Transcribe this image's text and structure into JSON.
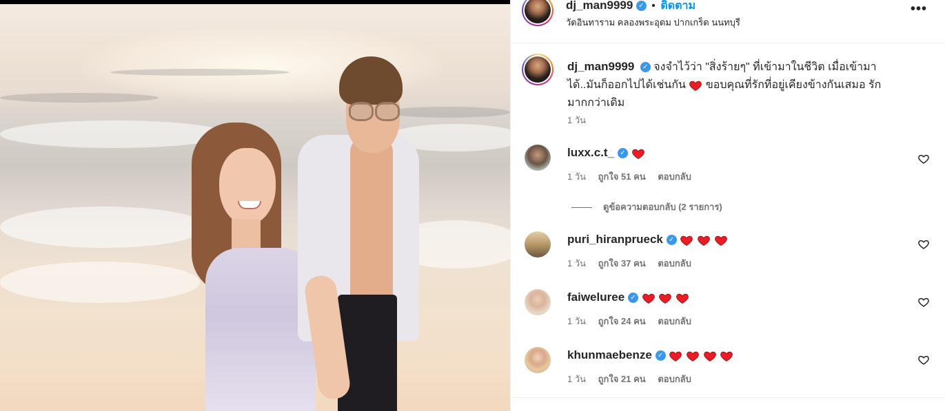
{
  "post": {
    "author": "dj_man9999",
    "follow_label": "ติดตาม",
    "separator": "•",
    "location": "วัดอินทาราม คลองพระอุดม ปากเกร็ด นนทบุรี",
    "more_label": "•••",
    "caption": "จงจำไว้ว่า \"สิ่งร้ายๆ\" ที่เข้ามาในชีวิต เมื่อเข้ามาได้..มันก็ออกไปได้เช่นกัน ❤️ ขอบคุณที่รักที่อยู่เคียงข้างกันเสมอ รักมากกว่าเดิม",
    "caption_part1": "จงจำไว้ว่า \"สิ่งร้ายๆ\" ที่เข้ามาในชีวิต เมื่อเข้ามา",
    "caption_part2": "ได้..มันก็ออกไปได้เช่นกัน",
    "caption_part3": "ขอบคุณที่รักที่อยู่เคียงข้างกันเสมอ รัก",
    "caption_part4": "มากกว่าเดิม",
    "time": "1 วัน"
  },
  "comments": [
    {
      "username": "luxx.c.t_",
      "hearts": 1,
      "time": "1 วัน",
      "likes_label": "ถูกใจ",
      "likes": "51",
      "likes_unit": "คน",
      "reply_label": "ตอบกลับ"
    },
    {
      "username": "puri_hiranprueck",
      "hearts": 3,
      "time": "1 วัน",
      "likes_label": "ถูกใจ",
      "likes": "37",
      "likes_unit": "คน",
      "reply_label": "ตอบกลับ"
    },
    {
      "username": "faiweluree",
      "hearts": 3,
      "time": "1 วัน",
      "likes_label": "ถูกใจ",
      "likes": "24",
      "likes_unit": "คน",
      "reply_label": "ตอบกลับ"
    },
    {
      "username": "khunmaebenze",
      "hearts": 4,
      "time": "1 วัน",
      "likes_label": "ถูกใจ",
      "likes": "21",
      "likes_unit": "คน",
      "reply_label": "ตอบกลับ"
    }
  ],
  "view_replies_label": "ดูข้อความตอบกลับ (2 รายการ)",
  "colors": {
    "follow": "#0095f6",
    "verified": "#3897f0",
    "heart": "#ed1c24",
    "meta_text": "#737373"
  }
}
